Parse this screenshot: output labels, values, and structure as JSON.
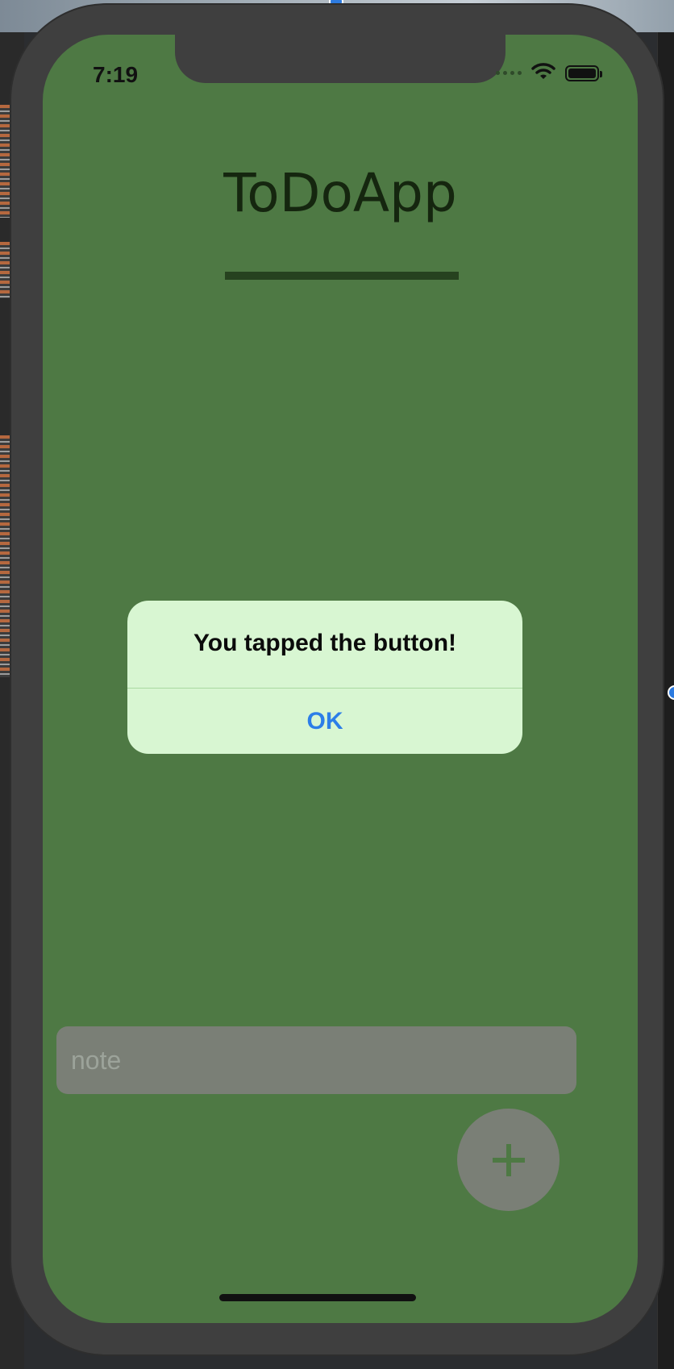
{
  "status_bar": {
    "time": "7:19",
    "icons": [
      "cellular-dots-icon",
      "wifi-icon",
      "battery-icon"
    ]
  },
  "app": {
    "title": "ToDoApp"
  },
  "alert": {
    "message": "You tapped the button!",
    "ok_label": "OK"
  },
  "note_input": {
    "placeholder": "note",
    "value": ""
  },
  "add_button": {
    "icon": "plus-icon"
  },
  "colors": {
    "screen_bg": "#4e7944",
    "alert_bg": "#d8f6d2",
    "accent": "#2c7ee8",
    "input_bg": "#7a7f76",
    "title_text": "#15260f",
    "title_bar": "#26421f"
  }
}
